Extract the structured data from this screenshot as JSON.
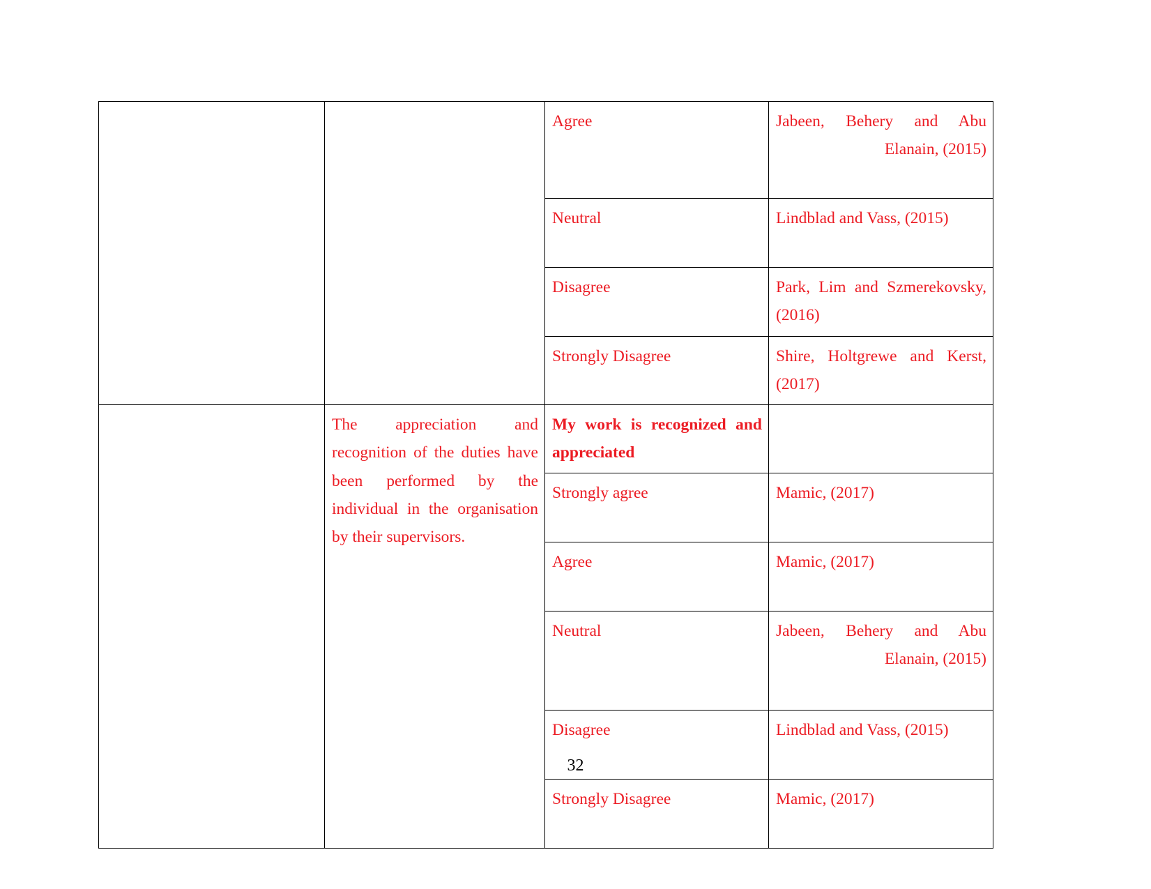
{
  "document": {
    "page_number": "32",
    "text_color": "#ec1c24",
    "border_color": "#000000",
    "background": "#ffffff"
  },
  "table": {
    "columns": [
      "theme",
      "description",
      "scale_option",
      "source"
    ],
    "rows": [
      {
        "theme": "",
        "description": "",
        "scale_option": "Agree",
        "source": "Jabeen, Behery and Abu Elanain, (2015)",
        "scale_bold": false
      },
      {
        "theme": "",
        "description": "",
        "scale_option": "Neutral",
        "source": "Lindblad and Vass, (2015)",
        "scale_bold": false
      },
      {
        "theme": "",
        "description": "",
        "scale_option": "Disagree",
        "source": "Park, Lim and Szmerekovsky, (2016)",
        "scale_bold": false
      },
      {
        "theme": "",
        "description": "",
        "scale_option": "Strongly Disagree",
        "source": "Shire, Holtgrewe and Kerst, (2017)",
        "scale_bold": false
      },
      {
        "theme": "",
        "description": "The appreciation and recognition of the duties have been performed by the individual in the organisation by their supervisors.",
        "scale_option": "My work is recognized and appreciated",
        "source": "",
        "scale_bold": true
      },
      {
        "theme": "",
        "description": "",
        "scale_option": "Strongly agree",
        "source": "Mamic, (2017)",
        "scale_bold": false
      },
      {
        "theme": "",
        "description": "",
        "scale_option": "Agree",
        "source": "Mamic, (2017)",
        "scale_bold": false
      },
      {
        "theme": "",
        "description": "",
        "scale_option": "Neutral",
        "source": "Jabeen, Behery and Abu Elanain, (2015)",
        "scale_bold": false
      },
      {
        "theme": "",
        "description": "",
        "scale_option": "Disagree",
        "source": "Lindblad and Vass, (2015)",
        "scale_bold": false
      },
      {
        "theme": "",
        "description": "",
        "scale_option": "Strongly Disagree",
        "source": "Mamic, (2017)",
        "scale_bold": false
      }
    ]
  }
}
